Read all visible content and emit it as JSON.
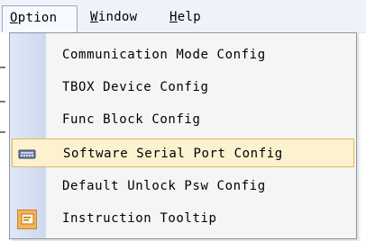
{
  "menubar": {
    "items": [
      {
        "label_pre": "",
        "mnemonic": "O",
        "label_post": "ption",
        "open": true
      },
      {
        "label_pre": "",
        "mnemonic": "W",
        "label_post": "indow",
        "open": false
      },
      {
        "label_pre": "",
        "mnemonic": "H",
        "label_post": "elp",
        "open": false
      }
    ]
  },
  "dropdown": {
    "items": [
      {
        "label": "Communication Mode Config",
        "icon": null,
        "highlighted": false
      },
      {
        "label": "TBOX Device Config",
        "icon": null,
        "highlighted": false
      },
      {
        "label": "Func Block Config",
        "icon": null,
        "highlighted": false
      },
      {
        "label": "Software Serial Port Config",
        "icon": "serial-port-icon",
        "highlighted": true
      },
      {
        "label": "Default Unlock Psw Config",
        "icon": null,
        "highlighted": false
      },
      {
        "label": "Instruction Tooltip",
        "icon": "tooltip-icon",
        "highlighted": false
      }
    ]
  },
  "colors": {
    "highlight_bg": "#fdf2cf",
    "highlight_border": "#e3b552",
    "gutter": "#cdd9ee",
    "menubar_bg": "#eef3fb"
  }
}
